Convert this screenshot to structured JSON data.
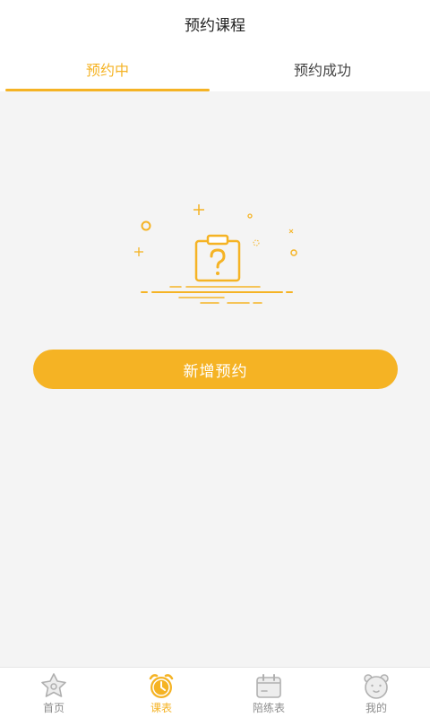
{
  "header": {
    "title": "预约课程"
  },
  "tabs": [
    {
      "label": "预约中",
      "active": true
    },
    {
      "label": "预约成功",
      "active": false
    }
  ],
  "main": {
    "empty_icon": "clipboard-question-icon",
    "button_label": "新增预约"
  },
  "bottom_nav": [
    {
      "label": "首页",
      "icon": "star-icon",
      "active": false
    },
    {
      "label": "课表",
      "icon": "alarm-clock-icon",
      "active": true
    },
    {
      "label": "陪练表",
      "icon": "calendar-icon",
      "active": false
    },
    {
      "label": "我的",
      "icon": "bear-face-icon",
      "active": false
    }
  ],
  "colors": {
    "accent": "#f5b324",
    "inactive": "#8c8c8c",
    "background": "#f4f4f4"
  }
}
